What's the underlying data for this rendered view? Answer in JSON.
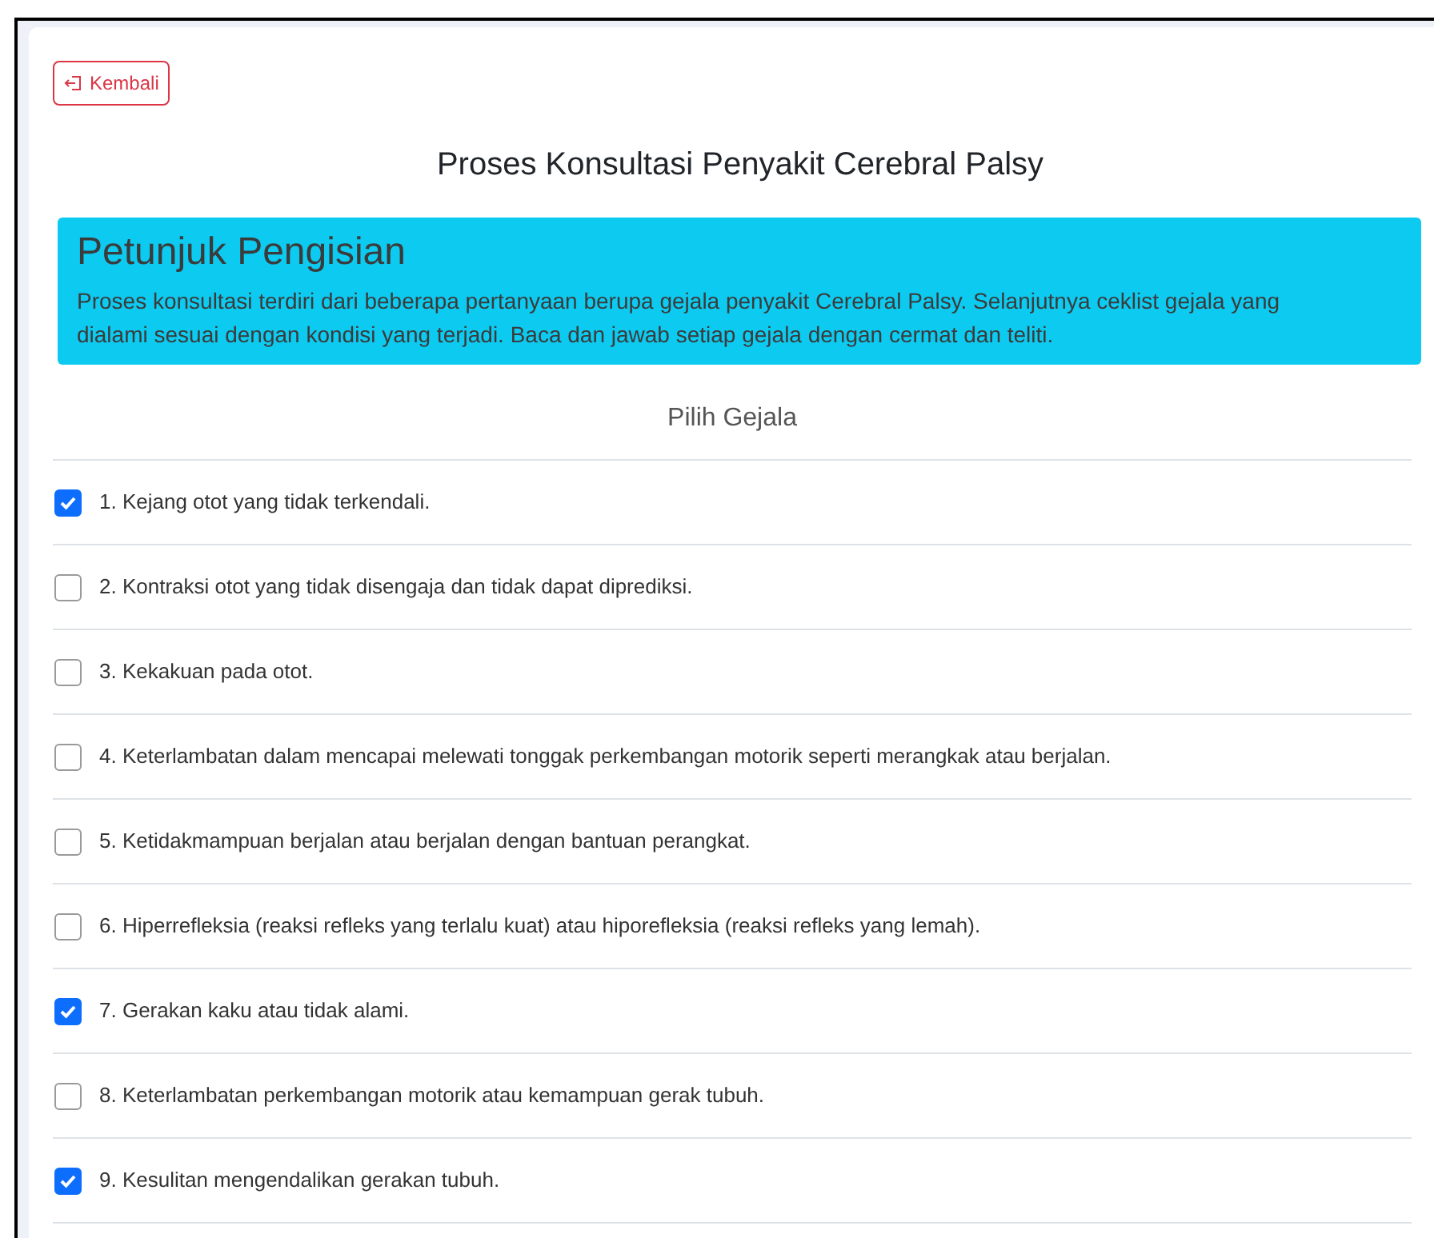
{
  "back_button": {
    "label": "Kembali"
  },
  "title": "Proses Konsultasi Penyakit Cerebral Palsy",
  "instructions": {
    "heading": "Petunjuk Pengisian",
    "text": "Proses konsultasi terdiri dari beberapa pertanyaan berupa gejala penyakit Cerebral Palsy. Selanjutnya ceklist gejala yang dialami sesuai dengan kondisi yang terjadi. Baca dan jawab setiap gejala dengan cermat dan teliti."
  },
  "symptoms_heading": "Pilih Gejala",
  "symptoms": [
    {
      "label": "1. Kejang otot yang tidak terkendali.",
      "checked": true
    },
    {
      "label": "2. Kontraksi otot yang tidak disengaja dan tidak dapat diprediksi.",
      "checked": false
    },
    {
      "label": "3. Kekakuan pada otot.",
      "checked": false
    },
    {
      "label": "4. Keterlambatan dalam mencapai melewati tonggak perkembangan motorik seperti merangkak atau berjalan.",
      "checked": false
    },
    {
      "label": "5. Ketidakmampuan berjalan atau berjalan dengan bantuan perangkat.",
      "checked": false
    },
    {
      "label": "6. Hiperrefleksia (reaksi refleks yang terlalu kuat) atau hiporefleksia (reaksi refleks yang lemah).",
      "checked": false
    },
    {
      "label": "7. Gerakan kaku atau tidak alami.",
      "checked": true
    },
    {
      "label": "8. Keterlambatan perkembangan motorik atau kemampuan gerak tubuh.",
      "checked": false
    },
    {
      "label": "9. Kesulitan mengendalikan gerakan tubuh.",
      "checked": true
    }
  ]
}
